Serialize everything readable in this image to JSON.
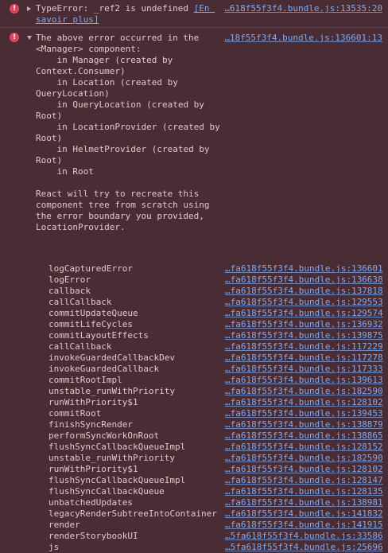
{
  "entries": [
    {
      "icon": "error-icon",
      "icon_glyph": "!",
      "message_prefix": "TypeError: _ref2 is undefined ",
      "message_link": "[En savoir plus]",
      "source": "…618f55f3f4.bundle.js:13535:20"
    },
    {
      "icon": "error-icon",
      "icon_glyph": "!",
      "message": "The above error occurred in the <Manager> component:\n    in Manager (created by Context.Consumer)\n    in Location (created by QueryLocation)\n    in QueryLocation (created by Root)\n    in LocationProvider (created by Root)\n    in HelmetProvider (created by Root)\n    in Root\n\nReact will try to recreate this component tree from scratch using the error boundary you provided, LocationProvider.",
      "source": "…18f55f3f4.bundle.js:136601:13",
      "stack": [
        {
          "fn": "logCapturedError",
          "src": "…fa618f55f3f4.bundle.js:136601"
        },
        {
          "fn": "logError",
          "src": "…fa618f55f3f4.bundle.js:136638"
        },
        {
          "fn": "callback",
          "src": "…fa618f55f3f4.bundle.js:137818"
        },
        {
          "fn": "callCallback",
          "src": "…fa618f55f3f4.bundle.js:129553"
        },
        {
          "fn": "commitUpdateQueue",
          "src": "…fa618f55f3f4.bundle.js:129574"
        },
        {
          "fn": "commitLifeCycles",
          "src": "…fa618f55f3f4.bundle.js:136932"
        },
        {
          "fn": "commitLayoutEffects",
          "src": "…fa618f55f3f4.bundle.js:139875"
        },
        {
          "fn": "callCallback",
          "src": "…fa618f55f3f4.bundle.js:117229"
        },
        {
          "fn": "invokeGuardedCallbackDev",
          "src": "…fa618f55f3f4.bundle.js:117278"
        },
        {
          "fn": "invokeGuardedCallback",
          "src": "…fa618f55f3f4.bundle.js:117333"
        },
        {
          "fn": "commitRootImpl",
          "src": "…fa618f55f3f4.bundle.js:139613"
        },
        {
          "fn": "unstable_runWithPriority",
          "src": "…fa618f55f3f4.bundle.js:182590"
        },
        {
          "fn": "runWithPriority$1",
          "src": "…fa618f55f3f4.bundle.js:128102"
        },
        {
          "fn": "commitRoot",
          "src": "…fa618f55f3f4.bundle.js:139453"
        },
        {
          "fn": "finishSyncRender",
          "src": "…fa618f55f3f4.bundle.js:138879"
        },
        {
          "fn": "performSyncWorkOnRoot",
          "src": "…fa618f55f3f4.bundle.js:138865"
        },
        {
          "fn": "flushSyncCallbackQueueImpl",
          "src": "…fa618f55f3f4.bundle.js:128152"
        },
        {
          "fn": "unstable_runWithPriority",
          "src": "…fa618f55f3f4.bundle.js:182590"
        },
        {
          "fn": "runWithPriority$1",
          "src": "…fa618f55f3f4.bundle.js:128102"
        },
        {
          "fn": "flushSyncCallbackQueueImpl",
          "src": "…fa618f55f3f4.bundle.js:128147"
        },
        {
          "fn": "flushSyncCallbackQueue",
          "src": "…fa618f55f3f4.bundle.js:128135"
        },
        {
          "fn": "unbatchedUpdates",
          "src": "…fa618f55f3f4.bundle.js:138981"
        },
        {
          "fn": "legacyRenderSubtreeIntoContainer",
          "src": "…fa618f55f3f4.bundle.js:141832"
        },
        {
          "fn": "render",
          "src": "…fa618f55f3f4.bundle.js:141915"
        },
        {
          "fn": "renderStorybookUI",
          "src": "…5fa618f55f3f4.bundle.js:33586"
        },
        {
          "fn": "js",
          "src": "…5fa618f55f3f4.bundle.js:25696"
        }
      ]
    }
  ],
  "colors": {
    "background": "#4a2c34",
    "text": "#e3c7cd",
    "link": "#7fa9ef",
    "error_icon": "#e2445c"
  }
}
